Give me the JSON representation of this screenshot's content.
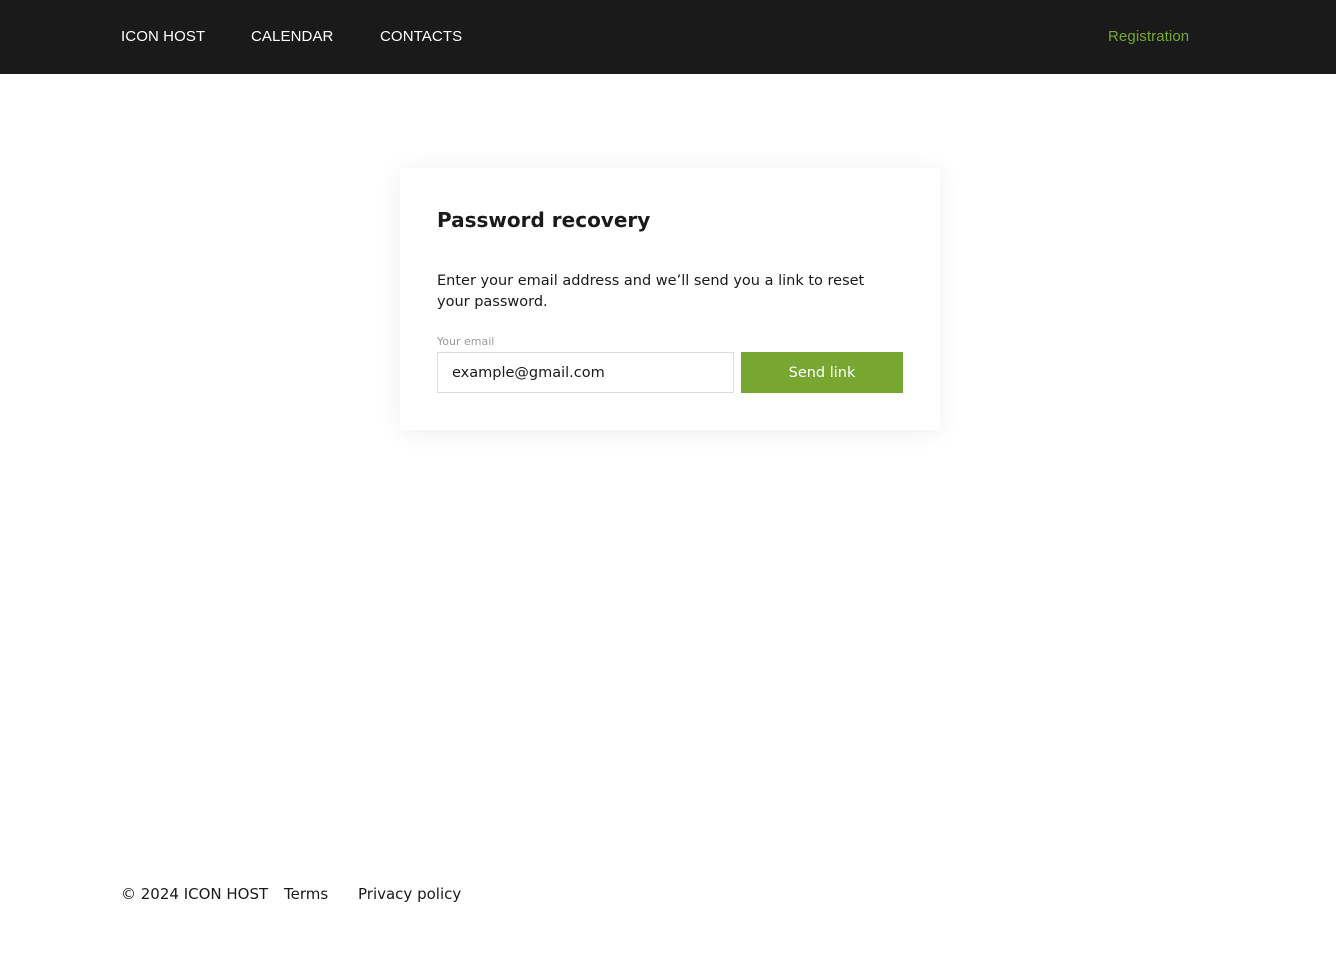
{
  "header": {
    "brand": "ICON HOST",
    "nav": {
      "calendar": "CALENDAR",
      "contacts": "CONTACTS"
    },
    "registration": "Registration"
  },
  "card": {
    "title": "Password recovery",
    "description": "Enter your email address and we’ll send you a link to reset your password.",
    "email_label": "Your email",
    "email_placeholder": "example@gmail.com",
    "email_value": "",
    "send_label": "Send link"
  },
  "footer": {
    "copyright": "© 2024 ICON HOST",
    "terms": "Terms",
    "privacy": "Privacy policy"
  },
  "colors": {
    "accent": "#77a631",
    "header_bg": "#1a1a1a",
    "text": "#1a1a1a"
  }
}
